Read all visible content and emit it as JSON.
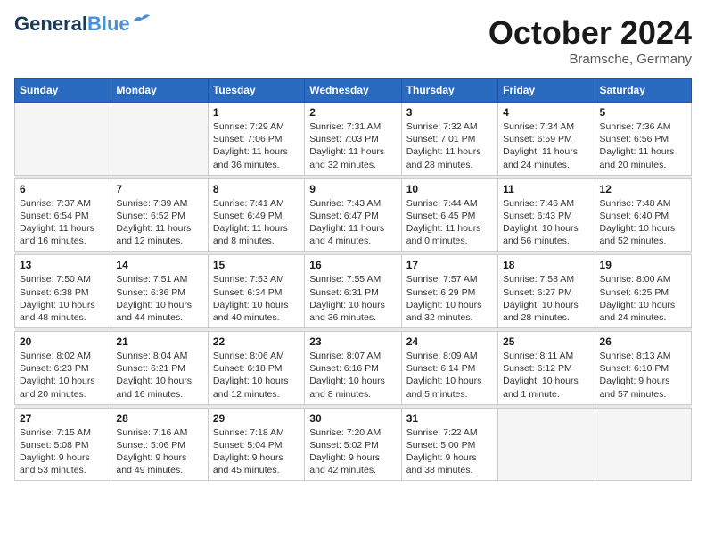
{
  "logo": {
    "line1": "General",
    "line2": "Blue"
  },
  "header": {
    "month": "October 2024",
    "location": "Bramsche, Germany"
  },
  "weekdays": [
    "Sunday",
    "Monday",
    "Tuesday",
    "Wednesday",
    "Thursday",
    "Friday",
    "Saturday"
  ],
  "weeks": [
    [
      {
        "day": "",
        "info": ""
      },
      {
        "day": "",
        "info": ""
      },
      {
        "day": "1",
        "info": "Sunrise: 7:29 AM\nSunset: 7:06 PM\nDaylight: 11 hours\nand 36 minutes."
      },
      {
        "day": "2",
        "info": "Sunrise: 7:31 AM\nSunset: 7:03 PM\nDaylight: 11 hours\nand 32 minutes."
      },
      {
        "day": "3",
        "info": "Sunrise: 7:32 AM\nSunset: 7:01 PM\nDaylight: 11 hours\nand 28 minutes."
      },
      {
        "day": "4",
        "info": "Sunrise: 7:34 AM\nSunset: 6:59 PM\nDaylight: 11 hours\nand 24 minutes."
      },
      {
        "day": "5",
        "info": "Sunrise: 7:36 AM\nSunset: 6:56 PM\nDaylight: 11 hours\nand 20 minutes."
      }
    ],
    [
      {
        "day": "6",
        "info": "Sunrise: 7:37 AM\nSunset: 6:54 PM\nDaylight: 11 hours\nand 16 minutes."
      },
      {
        "day": "7",
        "info": "Sunrise: 7:39 AM\nSunset: 6:52 PM\nDaylight: 11 hours\nand 12 minutes."
      },
      {
        "day": "8",
        "info": "Sunrise: 7:41 AM\nSunset: 6:49 PM\nDaylight: 11 hours\nand 8 minutes."
      },
      {
        "day": "9",
        "info": "Sunrise: 7:43 AM\nSunset: 6:47 PM\nDaylight: 11 hours\nand 4 minutes."
      },
      {
        "day": "10",
        "info": "Sunrise: 7:44 AM\nSunset: 6:45 PM\nDaylight: 11 hours\nand 0 minutes."
      },
      {
        "day": "11",
        "info": "Sunrise: 7:46 AM\nSunset: 6:43 PM\nDaylight: 10 hours\nand 56 minutes."
      },
      {
        "day": "12",
        "info": "Sunrise: 7:48 AM\nSunset: 6:40 PM\nDaylight: 10 hours\nand 52 minutes."
      }
    ],
    [
      {
        "day": "13",
        "info": "Sunrise: 7:50 AM\nSunset: 6:38 PM\nDaylight: 10 hours\nand 48 minutes."
      },
      {
        "day": "14",
        "info": "Sunrise: 7:51 AM\nSunset: 6:36 PM\nDaylight: 10 hours\nand 44 minutes."
      },
      {
        "day": "15",
        "info": "Sunrise: 7:53 AM\nSunset: 6:34 PM\nDaylight: 10 hours\nand 40 minutes."
      },
      {
        "day": "16",
        "info": "Sunrise: 7:55 AM\nSunset: 6:31 PM\nDaylight: 10 hours\nand 36 minutes."
      },
      {
        "day": "17",
        "info": "Sunrise: 7:57 AM\nSunset: 6:29 PM\nDaylight: 10 hours\nand 32 minutes."
      },
      {
        "day": "18",
        "info": "Sunrise: 7:58 AM\nSunset: 6:27 PM\nDaylight: 10 hours\nand 28 minutes."
      },
      {
        "day": "19",
        "info": "Sunrise: 8:00 AM\nSunset: 6:25 PM\nDaylight: 10 hours\nand 24 minutes."
      }
    ],
    [
      {
        "day": "20",
        "info": "Sunrise: 8:02 AM\nSunset: 6:23 PM\nDaylight: 10 hours\nand 20 minutes."
      },
      {
        "day": "21",
        "info": "Sunrise: 8:04 AM\nSunset: 6:21 PM\nDaylight: 10 hours\nand 16 minutes."
      },
      {
        "day": "22",
        "info": "Sunrise: 8:06 AM\nSunset: 6:18 PM\nDaylight: 10 hours\nand 12 minutes."
      },
      {
        "day": "23",
        "info": "Sunrise: 8:07 AM\nSunset: 6:16 PM\nDaylight: 10 hours\nand 8 minutes."
      },
      {
        "day": "24",
        "info": "Sunrise: 8:09 AM\nSunset: 6:14 PM\nDaylight: 10 hours\nand 5 minutes."
      },
      {
        "day": "25",
        "info": "Sunrise: 8:11 AM\nSunset: 6:12 PM\nDaylight: 10 hours\nand 1 minute."
      },
      {
        "day": "26",
        "info": "Sunrise: 8:13 AM\nSunset: 6:10 PM\nDaylight: 9 hours\nand 57 minutes."
      }
    ],
    [
      {
        "day": "27",
        "info": "Sunrise: 7:15 AM\nSunset: 5:08 PM\nDaylight: 9 hours\nand 53 minutes."
      },
      {
        "day": "28",
        "info": "Sunrise: 7:16 AM\nSunset: 5:06 PM\nDaylight: 9 hours\nand 49 minutes."
      },
      {
        "day": "29",
        "info": "Sunrise: 7:18 AM\nSunset: 5:04 PM\nDaylight: 9 hours\nand 45 minutes."
      },
      {
        "day": "30",
        "info": "Sunrise: 7:20 AM\nSunset: 5:02 PM\nDaylight: 9 hours\nand 42 minutes."
      },
      {
        "day": "31",
        "info": "Sunrise: 7:22 AM\nSunset: 5:00 PM\nDaylight: 9 hours\nand 38 minutes."
      },
      {
        "day": "",
        "info": ""
      },
      {
        "day": "",
        "info": ""
      }
    ]
  ]
}
